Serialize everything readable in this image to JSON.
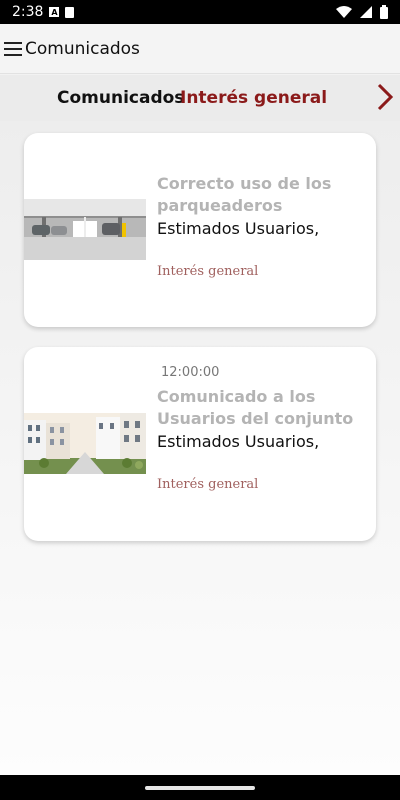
{
  "status_bar": {
    "time": "2:38",
    "icons": [
      "a-icon",
      "sd-card-icon",
      "wifi-icon",
      "signal-icon",
      "battery-icon"
    ]
  },
  "app_bar": {
    "title": "Comunicados",
    "menu_icon": "menu-icon"
  },
  "tabs": {
    "items": [
      {
        "label": "Comunicados",
        "active": false
      },
      {
        "label": "Interés general",
        "active": true
      }
    ],
    "next_icon": "chevron-right-icon",
    "accent_color": "#8b1a1a"
  },
  "cards": [
    {
      "time": "",
      "title": "Correcto uso de los parqueaderos",
      "body": "Estimados Usuarios,",
      "category": "Interés general",
      "image": "parking-garage-image"
    },
    {
      "time": "12:00:00",
      "title": "Comunicado a los Usuarios del conjunto",
      "body": "Estimados Usuarios,",
      "category": "Interés general",
      "image": "apartment-buildings-image"
    }
  ]
}
